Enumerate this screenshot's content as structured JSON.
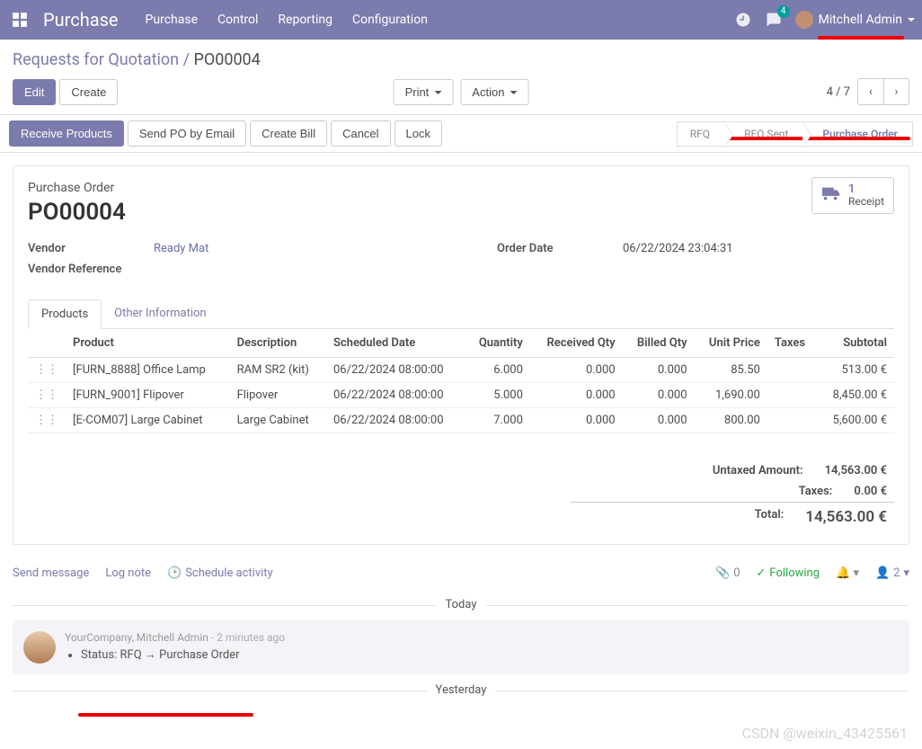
{
  "topbar": {
    "app": "Purchase",
    "menus": [
      "Purchase",
      "Control",
      "Reporting",
      "Configuration"
    ],
    "chat_badge": "4",
    "username": "Mitchell Admin"
  },
  "breadcrumb": {
    "root": "Requests for Quotation",
    "current": "PO00004"
  },
  "controls": {
    "edit": "Edit",
    "create": "Create",
    "print": "Print",
    "action": "Action",
    "pager": "4 / 7"
  },
  "action_bar": {
    "receive": "Receive Products",
    "send_po": "Send PO by Email",
    "create_bill": "Create Bill",
    "cancel": "Cancel",
    "lock": "Lock",
    "status": [
      "RFQ",
      "RFQ Sent",
      "Purchase Order"
    ]
  },
  "form": {
    "header_label": "Purchase Order",
    "name": "PO00004",
    "statbox_n": "1",
    "statbox_t": "Receipt",
    "vendor_label": "Vendor",
    "vendor": "Ready Mat",
    "vendor_ref_label": "Vendor Reference",
    "order_date_label": "Order Date",
    "order_date": "06/22/2024 23:04:31"
  },
  "tabs": {
    "products": "Products",
    "other": "Other Information"
  },
  "cols": {
    "product": "Product",
    "description": "Description",
    "sched": "Scheduled Date",
    "qty": "Quantity",
    "recv": "Received Qty",
    "billed": "Billed Qty",
    "price": "Unit Price",
    "taxes": "Taxes",
    "subtotal": "Subtotal"
  },
  "lines": [
    {
      "product": "[FURN_8888] Office Lamp",
      "desc": "RAM SR2 (kit)",
      "sched": "06/22/2024 08:00:00",
      "qty": "6.000",
      "recv": "0.000",
      "billed": "0.000",
      "price": "85.50",
      "sub": "513.00 €"
    },
    {
      "product": "[FURN_9001] Flipover",
      "desc": "Flipover",
      "sched": "06/22/2024 08:00:00",
      "qty": "5.000",
      "recv": "0.000",
      "billed": "0.000",
      "price": "1,690.00",
      "sub": "8,450.00 €"
    },
    {
      "product": "[E-COM07] Large Cabinet",
      "desc": "Large Cabinet",
      "sched": "06/22/2024 08:00:00",
      "qty": "7.000",
      "recv": "0.000",
      "billed": "0.000",
      "price": "800.00",
      "sub": "5,600.00 €"
    }
  ],
  "totals": {
    "untaxed_lbl": "Untaxed Amount:",
    "untaxed": "14,563.00 €",
    "taxes_lbl": "Taxes:",
    "taxes": "0.00 €",
    "total_lbl": "Total:",
    "total": "14,563.00 €"
  },
  "chatter": {
    "send": "Send message",
    "log": "Log note",
    "sched": "Schedule activity",
    "attach": "0",
    "following": "Following",
    "followers": "2",
    "today": "Today",
    "yesterday": "Yesterday",
    "msg_name": "YourCompany, Mitchell Admin",
    "msg_time": "- 2 minutes ago",
    "msg_line": "Status: RFQ → Purchase Order"
  },
  "watermark": "CSDN @weixin_43425561"
}
